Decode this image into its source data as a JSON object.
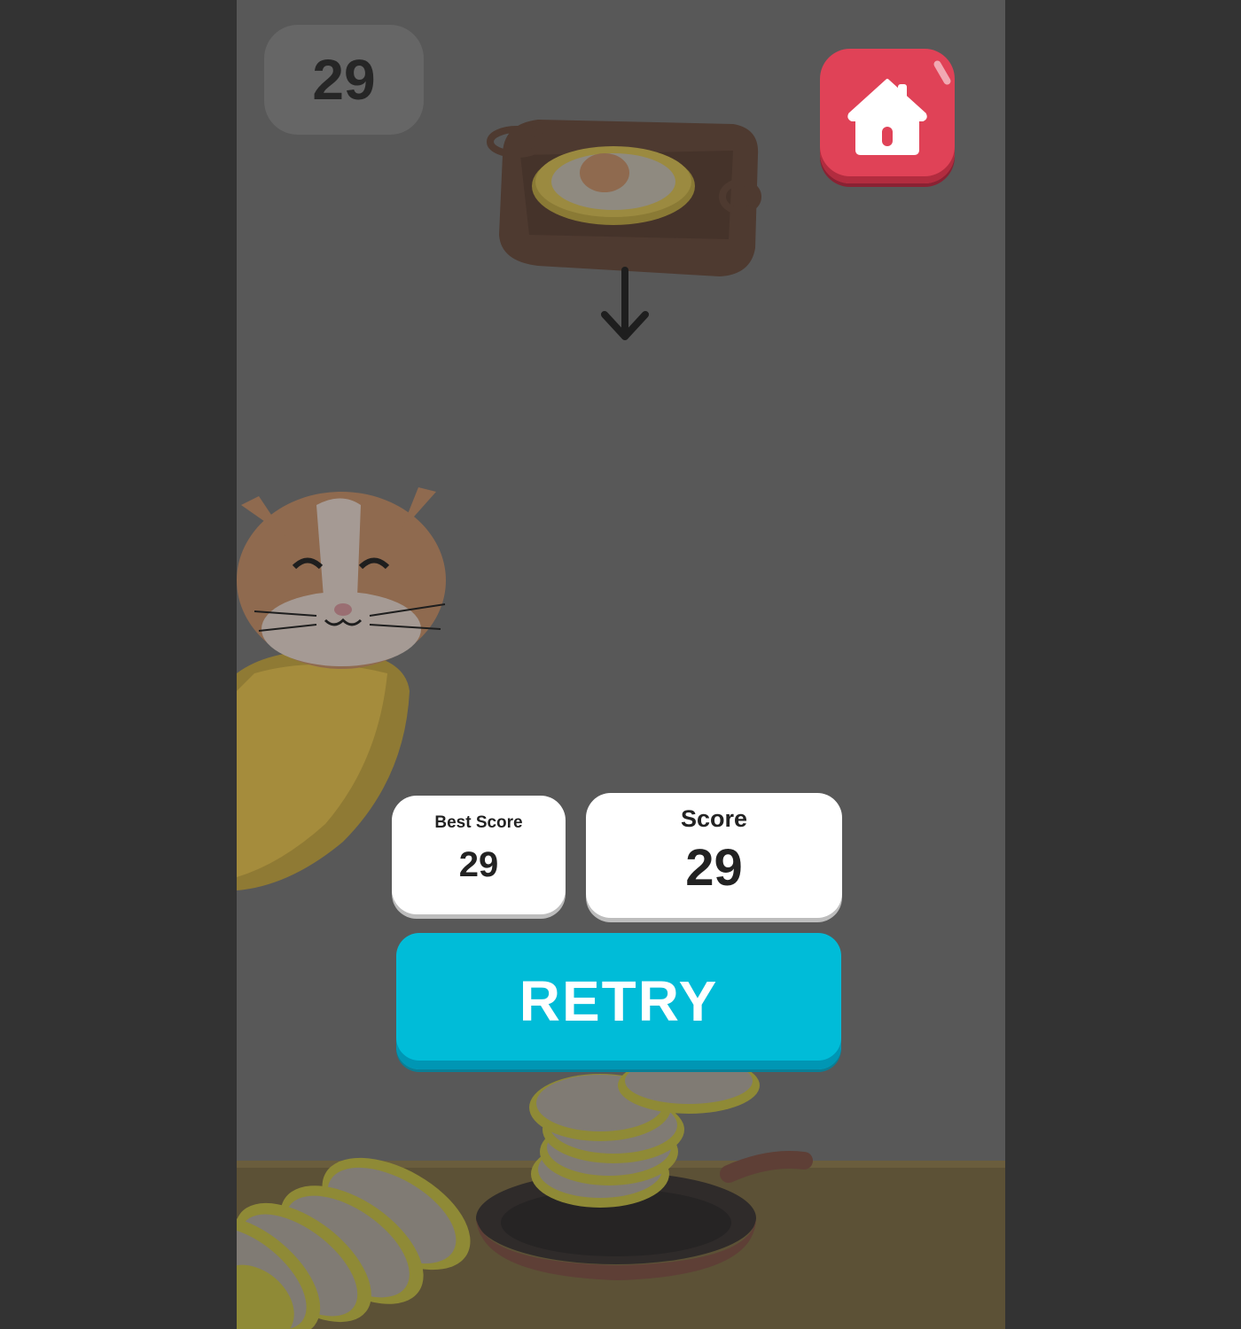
{
  "hud": {
    "current_score": "29"
  },
  "results": {
    "best_score_label": "Best Score",
    "best_score_value": "29",
    "score_label": "Score",
    "score_value": "29"
  },
  "buttons": {
    "retry_label": "RETRY",
    "home_icon": "home-icon"
  },
  "colors": {
    "background_outer": "#333333",
    "game_background": "#585858",
    "home_button": "#e04257",
    "retry_button": "#00bcd8",
    "card": "#ffffff"
  }
}
